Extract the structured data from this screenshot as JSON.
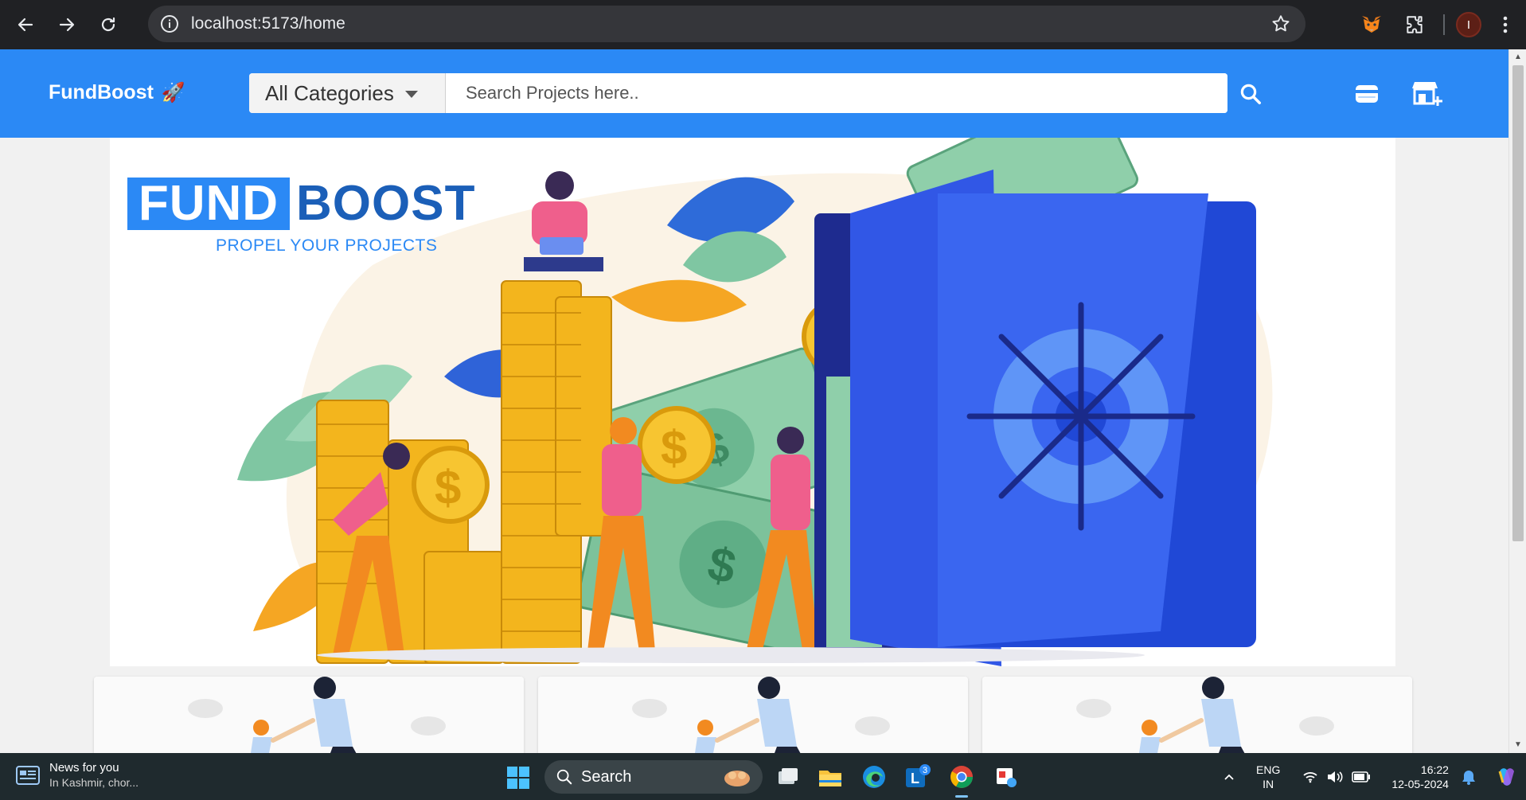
{
  "browser": {
    "url": "localhost:5173/home",
    "profile_initial": "I"
  },
  "appbar": {
    "brand": "FundBoost",
    "brand_emoji": "🚀",
    "category_select": "All Categories",
    "search_placeholder": "Search Projects here.."
  },
  "hero": {
    "logo_fund": "FUND",
    "logo_boost": "BOOST",
    "tagline": "PROPEL YOUR PROJECTS"
  },
  "taskbar": {
    "news_title": "News for you",
    "news_subtitle": "In Kashmir, chor...",
    "search_label": "Search",
    "mail_badge": "3",
    "lang_top": "ENG",
    "lang_bottom": "IN",
    "time": "16:22",
    "date": "12-05-2024"
  },
  "colors": {
    "appbar": "#2b89f5",
    "chrome": "#202124",
    "taskbar": "#1f2a2e",
    "logo_dark": "#1b5fb8"
  }
}
